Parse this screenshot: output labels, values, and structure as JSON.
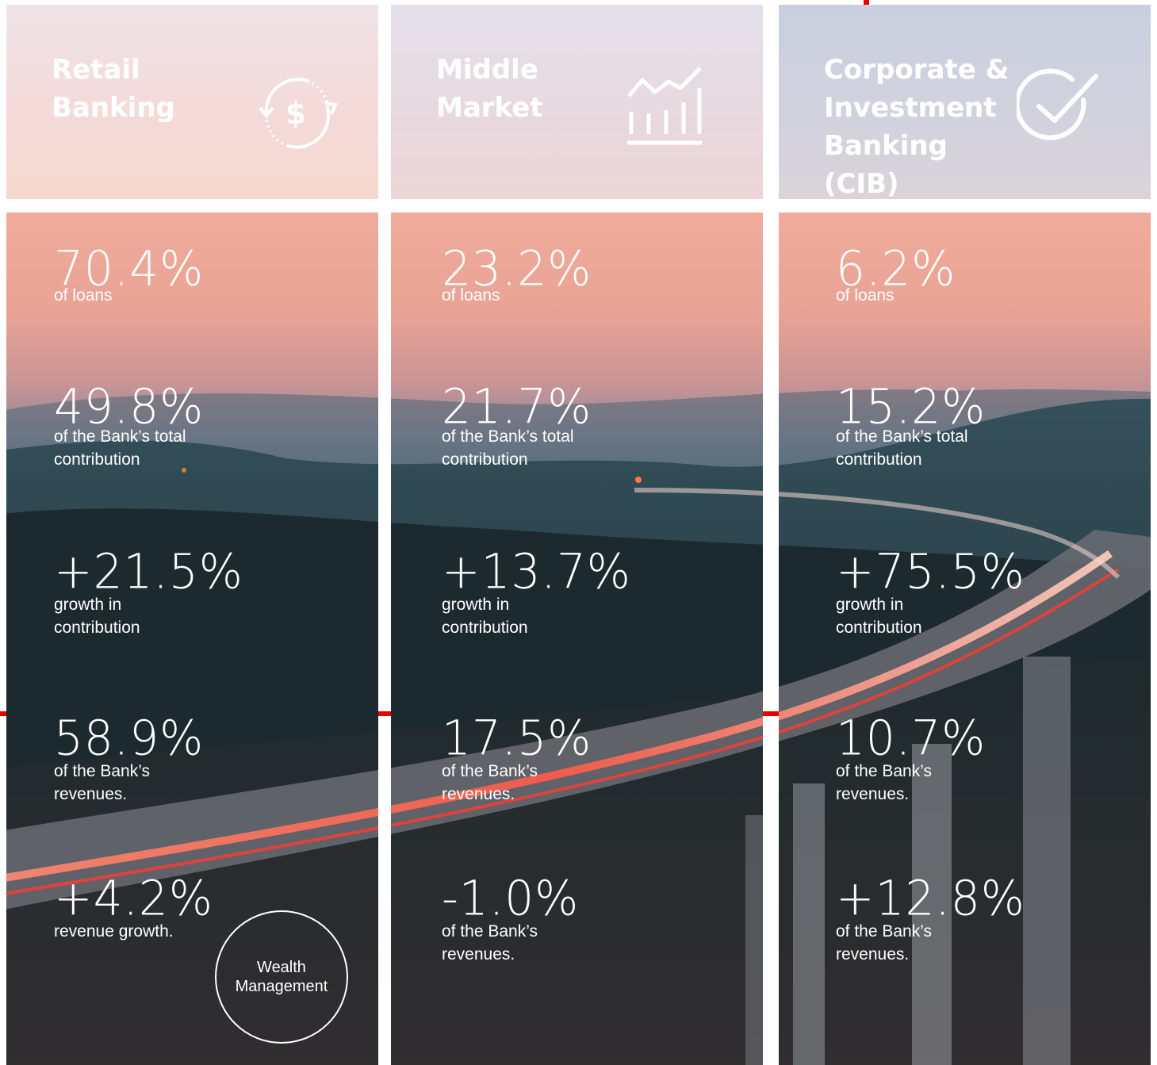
{
  "colors": {
    "accent_red": "#e60000",
    "text": "#ffffff",
    "sky_top": "#f3b7a6",
    "hills": "#1f3038"
  },
  "segments": [
    {
      "title": "Retail\nBanking",
      "icon": "dollar-cycle-icon",
      "stats": [
        {
          "value": "70.4%",
          "label": "of loans"
        },
        {
          "value": "49.8%",
          "label": "of the Bank’s total\ncontribution"
        },
        {
          "value": "+21.5%",
          "label": "growth in\ncontribution"
        },
        {
          "value": "58.9%",
          "label": "of the Bank’s\nrevenues."
        },
        {
          "value": "+4.2%",
          "label": "revenue growth."
        }
      ],
      "badge": "Wealth\nManagement"
    },
    {
      "title": "Middle\nMarket",
      "icon": "growth-chart-icon",
      "stats": [
        {
          "value": "23.2%",
          "label": "of loans"
        },
        {
          "value": "21.7%",
          "label": "of the Bank’s total\ncontribution"
        },
        {
          "value": "+13.7%",
          "label": "growth in\ncontribution"
        },
        {
          "value": "17.5%",
          "label": "of the Bank’s\nrevenues."
        },
        {
          "value": "-1.0%",
          "label": "of the Bank’s\nrevenues."
        }
      ]
    },
    {
      "title": "Corporate &\nInvestment\nBanking (CIB)",
      "icon": "check-circle-icon",
      "stats": [
        {
          "value": "6.2%",
          "label": "of loans"
        },
        {
          "value": "15.2%",
          "label": "of the Bank’s total\ncontribution"
        },
        {
          "value": "+75.5%",
          "label": "growth in\ncontribution"
        },
        {
          "value": "10.7%",
          "label": "of the Bank’s\nrevenues."
        },
        {
          "value": "+12.8%",
          "label": "of the Bank’s\nrevenues."
        }
      ]
    }
  ]
}
